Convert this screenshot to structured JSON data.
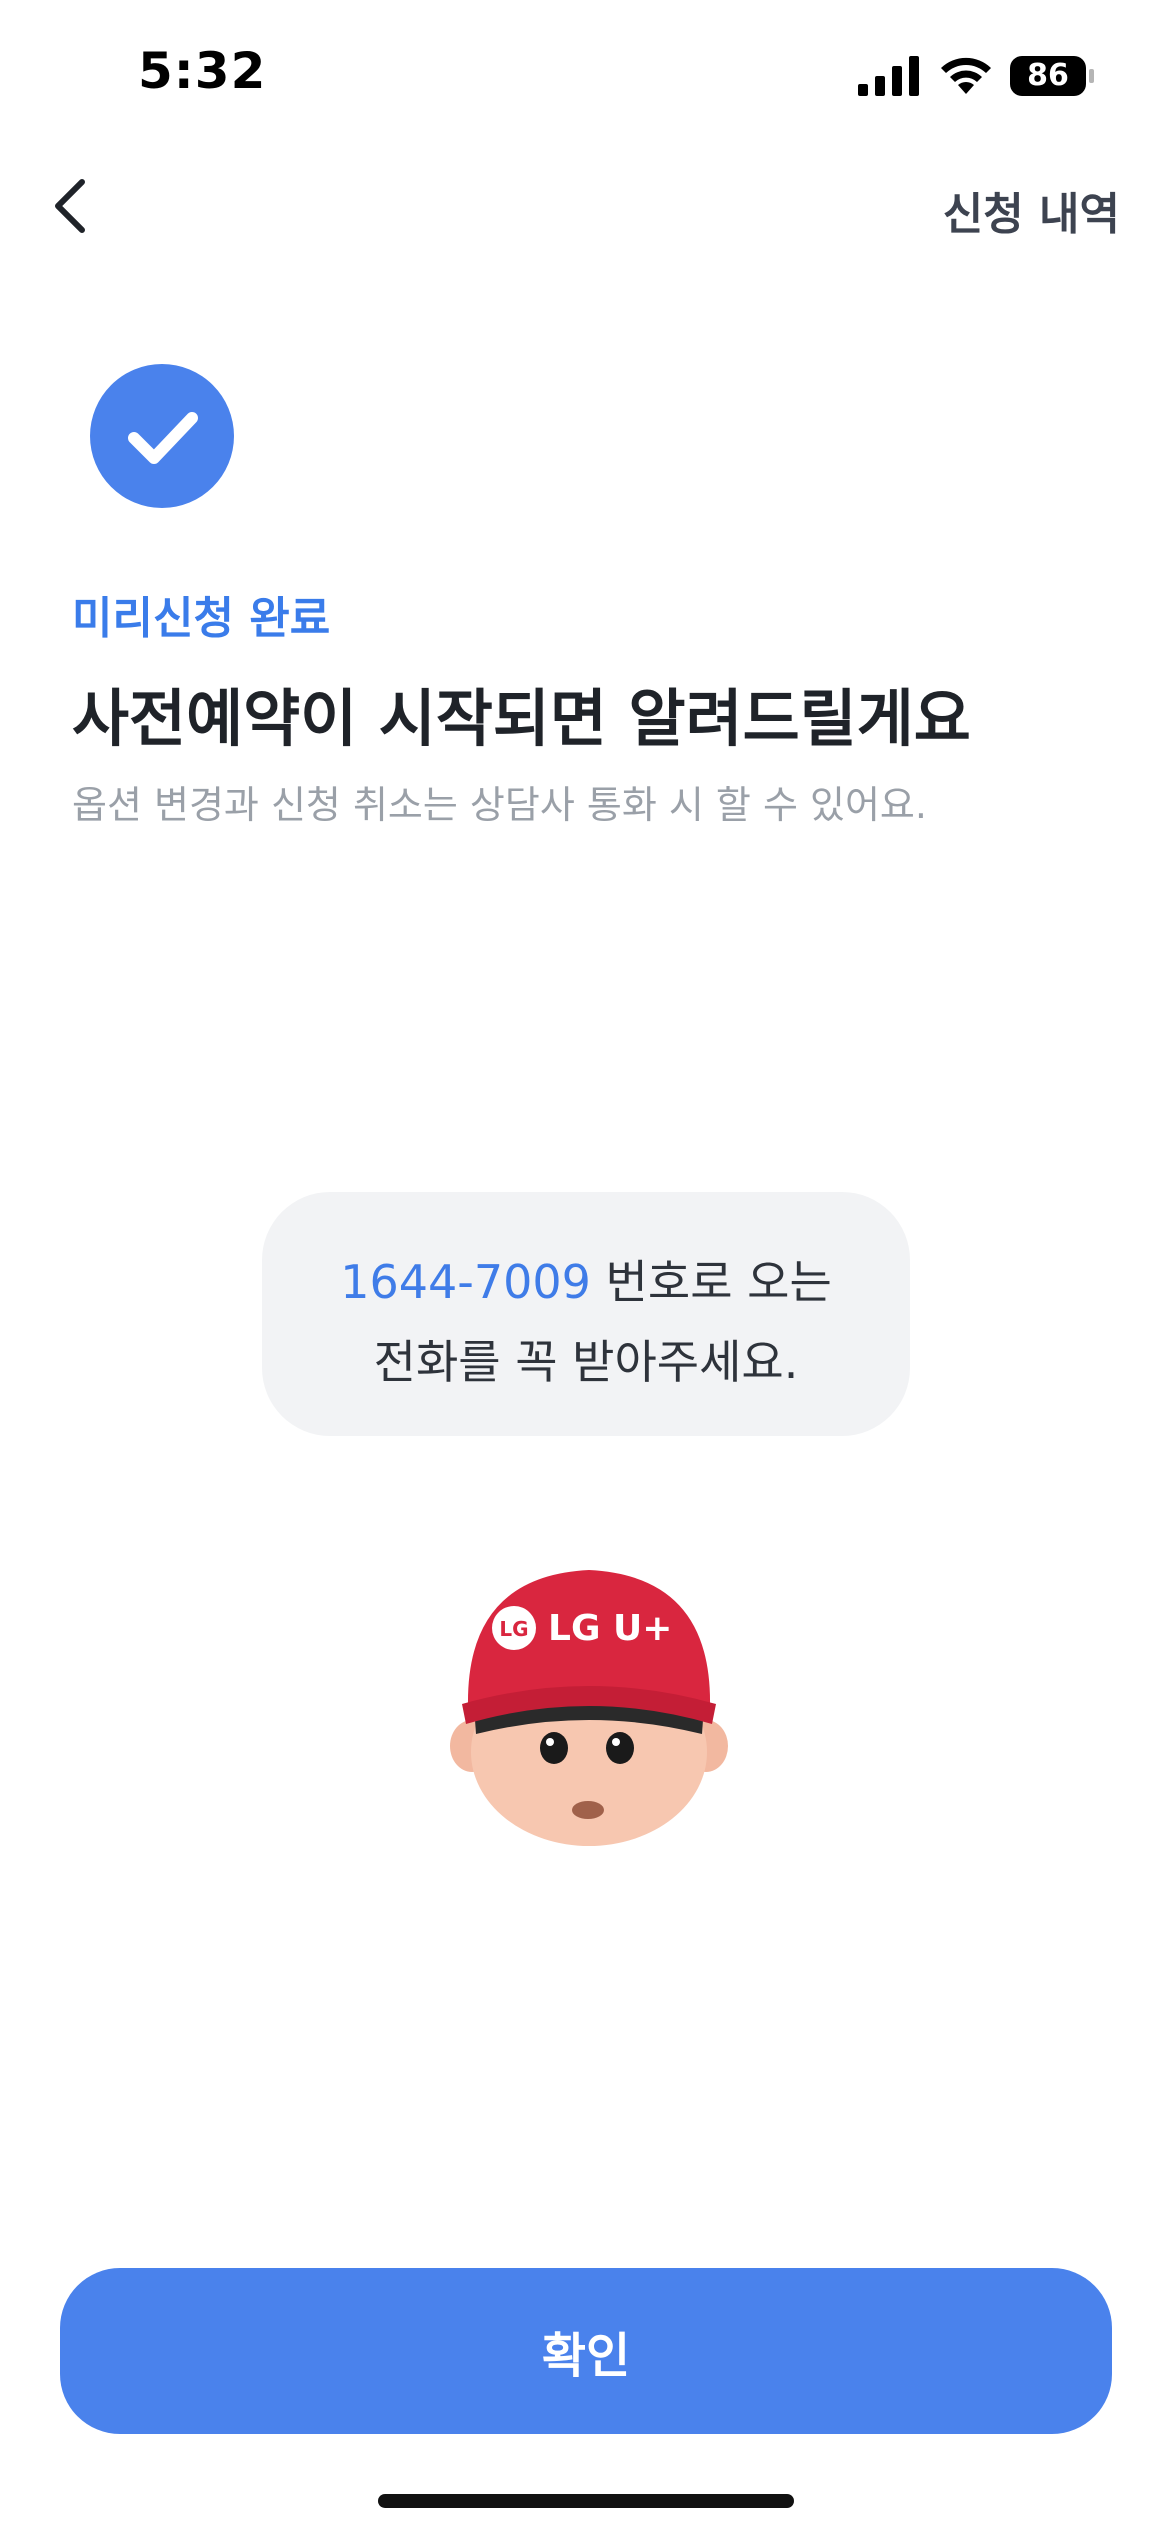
{
  "status_bar": {
    "time": "5:32",
    "battery": "86"
  },
  "nav": {
    "back_icon": "chevron-left-icon",
    "history_label": "신청 내역"
  },
  "result": {
    "status_icon": "check-icon",
    "eyebrow": "미리신청 완료",
    "headline": "사전예약이 시작되면 알려드릴게요",
    "subtext": "옵션 변경과 신청 취소는 상담사 통화 시 할 수 있어요."
  },
  "notice": {
    "phone": "1644-7009",
    "line1_rest": " 번호로 오는",
    "line2": "전화를 꼭 받아주세요."
  },
  "mascot": {
    "cap_logo": "LG U+"
  },
  "confirm_label": "확인",
  "colors": {
    "accent": "#4a82ec",
    "cap_red": "#d9263f"
  }
}
